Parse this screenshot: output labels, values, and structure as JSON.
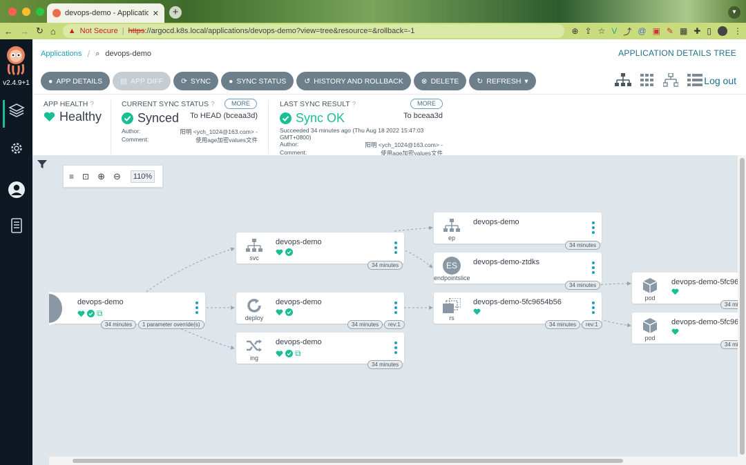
{
  "browser": {
    "tab_title": "devops-demo - Application De",
    "new_tab": "+",
    "security": "Not Secure",
    "url_https": "https",
    "url_rest": "://argocd.k8s.local/applications/devops-demo?view=tree&resource=&rollback=-1"
  },
  "sidebar": {
    "version": "v2.4.9+1"
  },
  "breadcrumb": {
    "root": "Applications",
    "current": "devops-demo"
  },
  "page_title": "APPLICATION DETAILS TREE",
  "toolbar": {
    "app_details": "APP DETAILS",
    "app_diff": "APP DIFF",
    "sync": "SYNC",
    "sync_status": "SYNC STATUS",
    "history": "HISTORY AND ROLLBACK",
    "delete": "DELETE",
    "refresh": "REFRESH"
  },
  "logout": "Log out",
  "health": {
    "label": "APP HEALTH",
    "value": "Healthy"
  },
  "current_sync": {
    "label": "CURRENT SYNC STATUS",
    "more": "MORE",
    "value": "Synced",
    "target": "To HEAD (bceaa3d)",
    "author_label": "Author:",
    "author": "阳明 <ych_1024@163.com> -",
    "comment_label": "Comment:",
    "comment": "使用age加密values文件"
  },
  "last_sync": {
    "label": "LAST SYNC RESULT",
    "more": "MORE",
    "value": "Sync OK",
    "target": "To bceaa3d",
    "succeeded": "Succeeded 34 minutes ago (Thu Aug 18 2022 15:47:03",
    "succeeded2": "GMT+0800)",
    "author_label": "Author:",
    "author": "阳明 <ych_1024@163.com> -",
    "comment_label": "Comment:",
    "comment": "使用age加密values文件"
  },
  "zoom": {
    "percent": "110%"
  },
  "nodes": {
    "app": {
      "name": "devops-demo",
      "age": "34 minutes",
      "extra": "1 parameter override(s)"
    },
    "svc": {
      "name": "devops-demo",
      "kind": "svc",
      "age": "34 minutes"
    },
    "deploy": {
      "name": "devops-demo",
      "kind": "deploy",
      "age": "34 minutes",
      "rev": "rev:1"
    },
    "ing": {
      "name": "devops-demo",
      "kind": "ing",
      "age": "34 minutes"
    },
    "ep": {
      "name": "devops-demo",
      "kind": "ep",
      "age": "34 minutes"
    },
    "eps": {
      "name": "devops-demo-ztdks",
      "kind": "endpointslice",
      "icon_text": "ES",
      "age": "34 minutes"
    },
    "rs": {
      "name": "devops-demo-5fc9654b56",
      "kind": "rs",
      "age": "34 minutes",
      "rev": "rev:1"
    },
    "pod1": {
      "name": "devops-demo-5fc96",
      "kind": "pod",
      "age": "34 mi"
    },
    "pod2": {
      "name": "devops-demo-5fc96",
      "kind": "pod",
      "age": "34 mi"
    }
  },
  "colors": {
    "healthy": "#18be94",
    "link": "#18a1b8",
    "button": "#6d7f8b"
  }
}
